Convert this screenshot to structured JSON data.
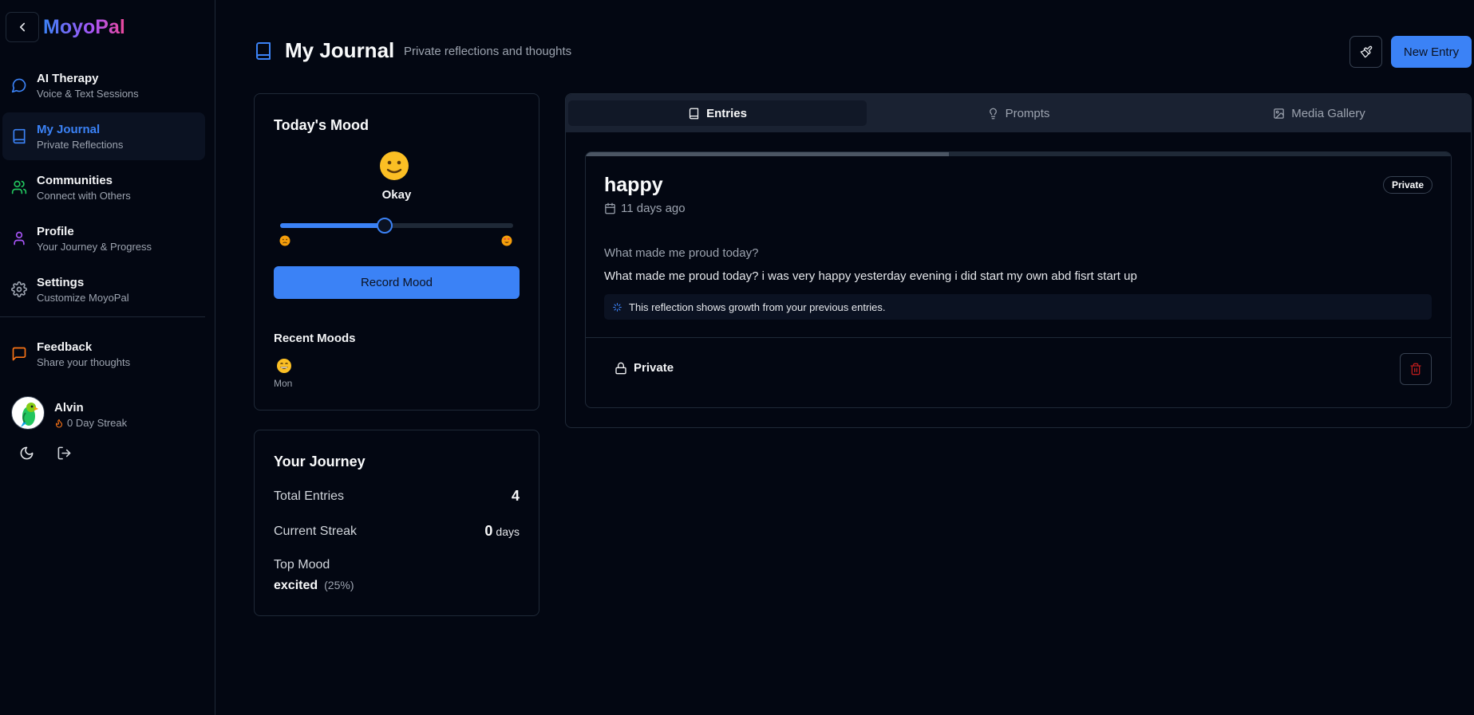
{
  "app": {
    "brand": "MoyoPal"
  },
  "sidebar": {
    "items": [
      {
        "title": "AI Therapy",
        "subtitle": "Voice & Text Sessions",
        "icon": "chat-bubble-icon",
        "color": "#3b82f6"
      },
      {
        "title": "My Journal",
        "subtitle": "Private Reflections",
        "icon": "book-icon",
        "color": "#3b82f6",
        "active": true
      },
      {
        "title": "Communities",
        "subtitle": "Connect with Others",
        "icon": "users-icon",
        "color": "#22c55e"
      },
      {
        "title": "Profile",
        "subtitle": "Your Journey & Progress",
        "icon": "user-icon",
        "color": "#a855f7"
      },
      {
        "title": "Settings",
        "subtitle": "Customize MoyoPal",
        "icon": "gear-icon",
        "color": "#9ca3af"
      }
    ],
    "feedback": {
      "title": "Feedback",
      "subtitle": "Share your thoughts",
      "icon": "message-square-icon",
      "color": "#f97316"
    },
    "user": {
      "name": "Alvin",
      "streak": "0 Day Streak"
    }
  },
  "header": {
    "title": "My Journal",
    "subtitle": "Private reflections and thoughts",
    "new_entry_label": "New Entry"
  },
  "mood": {
    "title": "Today's Mood",
    "current_label": "Okay",
    "slider_fraction": 0.45,
    "record_label": "Record Mood",
    "recent_title": "Recent Moods",
    "recent": [
      {
        "day": "Mon",
        "emoji": "grinning-face"
      }
    ]
  },
  "journey": {
    "title": "Your Journey",
    "total_entries_label": "Total Entries",
    "total_entries_value": "4",
    "streak_label": "Current Streak",
    "streak_value": "0",
    "streak_unit": "days",
    "top_mood_label": "Top Mood",
    "top_mood_value": "excited",
    "top_mood_pct": "(25%)"
  },
  "tabs": [
    {
      "label": "Entries",
      "active": true
    },
    {
      "label": "Prompts"
    },
    {
      "label": "Media Gallery"
    }
  ],
  "entry": {
    "title": "happy",
    "date": "11 days ago",
    "badge": "Private",
    "prompt": "What made me proud today?",
    "body": "What made me proud today? i was very happy yesterday evening i did start my own abd fisrt start up",
    "insight": "This reflection shows growth from your previous entries.",
    "privacy_label": "Private",
    "progress_fraction": 0.42
  },
  "colors": {
    "accent": "#3b82f6",
    "background": "#030712",
    "border": "#1f2937",
    "danger": "#dc2626"
  }
}
